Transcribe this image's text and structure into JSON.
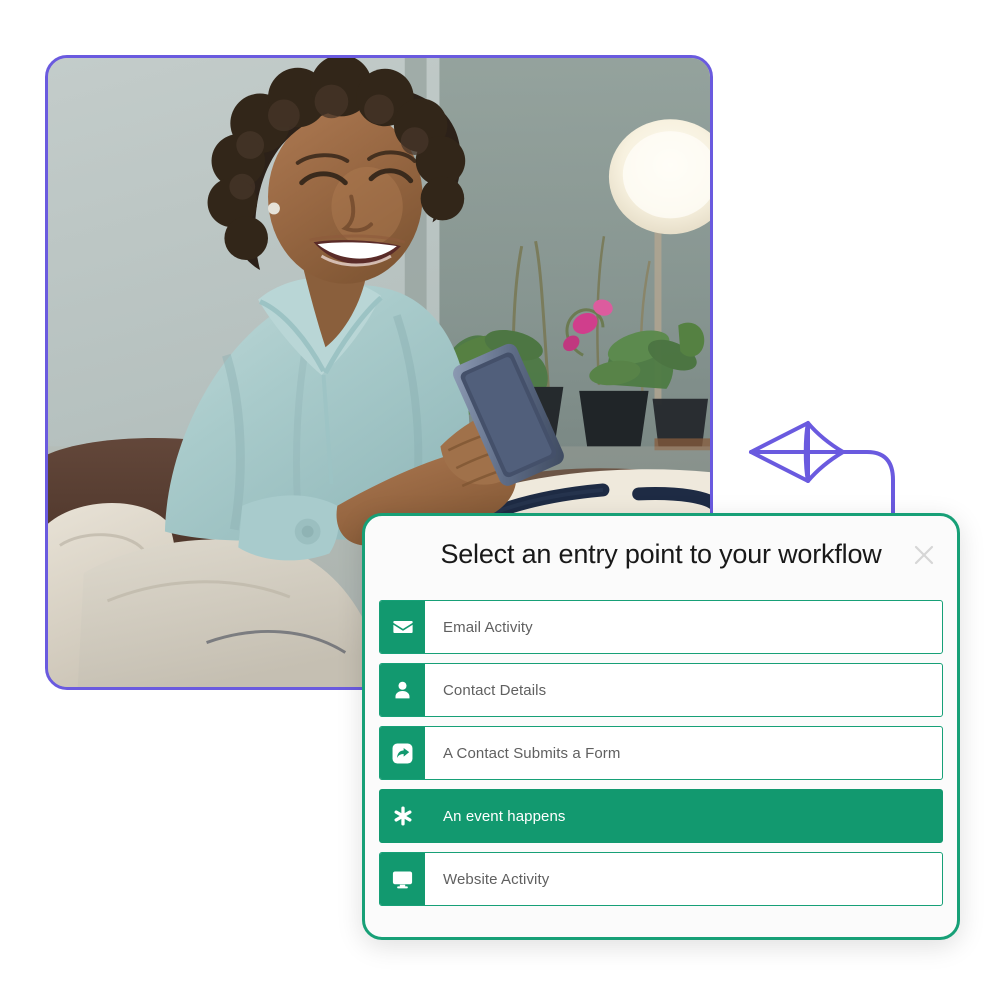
{
  "photo": {
    "alt_description": "Smiling woman sitting on a couch looking at her smartphone, with houseplants and a lamp in the background",
    "border_color": "#6A5ADF"
  },
  "connector": {
    "name": "curved-arrow-connector",
    "color": "#6A5ADF",
    "direction": "left"
  },
  "modal": {
    "title": "Select an entry point to your workflow",
    "close_label": "×",
    "border_color": "#17a077",
    "accent_color": "#12996f",
    "background": "#fbfbfb",
    "entry_points": [
      {
        "label": "Email Activity",
        "icon": "envelope-icon",
        "selected": false
      },
      {
        "label": "Contact Details",
        "icon": "person-icon",
        "selected": false
      },
      {
        "label": "A Contact Submits a Form",
        "icon": "share-icon",
        "selected": false
      },
      {
        "label": "An event happens",
        "icon": "asterisk-icon",
        "selected": true
      },
      {
        "label": "Website Activity",
        "icon": "monitor-icon",
        "selected": false
      }
    ]
  }
}
